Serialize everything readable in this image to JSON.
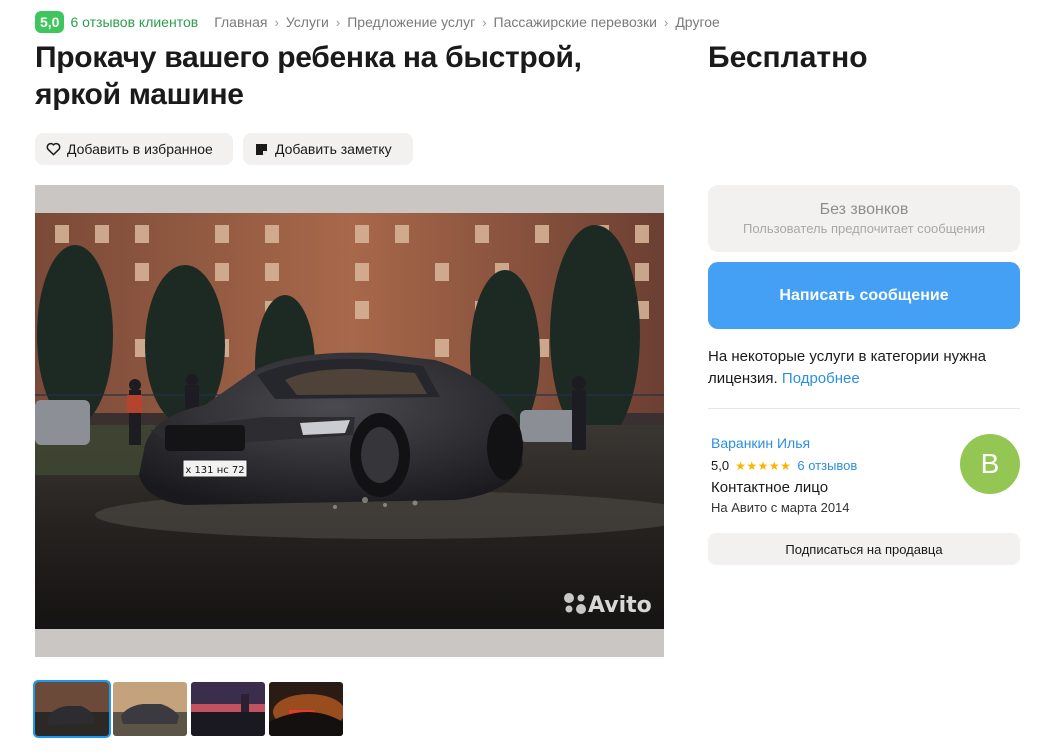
{
  "header": {
    "rating": "5,0",
    "reviews_link": "6 отзывов клиентов",
    "breadcrumbs": [
      "Главная",
      "Услуги",
      "Предложение услуг",
      "Пассажирские перевозки",
      "Другое"
    ]
  },
  "listing": {
    "title": "Прокачу вашего ребенка на быстрой, яркой машине",
    "price": "Бесплатно",
    "favorite_label": "Добавить в избранное",
    "note_label": "Добавить заметку",
    "photo": {
      "license_plate": "х 131 нс 72",
      "watermark": "Avito",
      "thumbnails": [
        "thumb-1",
        "thumb-2",
        "thumb-3",
        "thumb-4"
      ],
      "active_thumbnail": 1
    }
  },
  "contact": {
    "no_calls_title": "Без звонков",
    "no_calls_subtitle": "Пользователь предпочитает сообщения",
    "message_button": "Написать сообщение",
    "license_text": "На некоторые услуги в категории нужна лицензия.",
    "license_link": "Подробнее"
  },
  "seller": {
    "name": "Варанкин Илья",
    "rating": "5,0",
    "stars": "★★★★★",
    "reviews": "6 отзывов",
    "role": "Контактное лицо",
    "since": "На Авито с марта 2014",
    "avatar_letter": "В",
    "subscribe_button": "Подписаться на продавца"
  },
  "colors": {
    "accent_blue": "#43a0f5",
    "link_blue": "#2a8fe0",
    "rating_green": "#3fc55d",
    "avatar_green": "#94c654",
    "star_yellow": "#f8b500"
  },
  "icons": {
    "favorite": "heart-icon",
    "note": "note-icon",
    "breadcrumb_separator": "chevron-right-icon"
  }
}
